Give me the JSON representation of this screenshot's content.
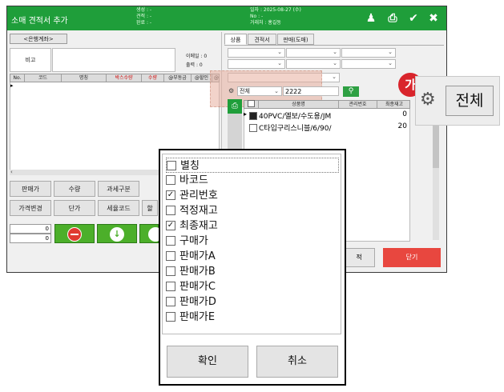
{
  "window": {
    "title": "소매 견적서 추가",
    "meta_left": [
      "생성 : -",
      "견적 : -",
      "완료 : -"
    ],
    "meta_right": [
      "일자 : 2025-08-27 (수)",
      "No : -",
      "거래처 : 홍길동"
    ]
  },
  "left": {
    "customer_button": "<은행계좌>",
    "memo_label": "비고",
    "summary": [
      "이메일 : 0",
      "출력 : 0"
    ],
    "grid_columns": [
      "No.",
      "코드",
      "명칭",
      "박스수량",
      "수량",
      "@부동금",
      "@할인",
      "@"
    ],
    "grid_column_colors": [
      "#222222",
      "#222222",
      "#222222",
      "#d01010",
      "#d01010",
      "#222222",
      "#222222",
      "#222222"
    ],
    "func_row1": [
      "판매가",
      "수량",
      "과세구분"
    ],
    "func_row2": [
      "가격변경",
      "단가",
      "세율코드",
      "할"
    ],
    "number_inputs": [
      "0",
      "0"
    ]
  },
  "right": {
    "tabs": [
      "상품",
      "견적서",
      "판매(도매)"
    ],
    "filter_select": "전체",
    "search_value": "2222",
    "grid_columns": [
      "상품명",
      "관리번호",
      "최종재고"
    ],
    "rows": [
      {
        "name": "40PVC/엘보/수도용/JM",
        "stock": "0"
      },
      {
        "name": "C타입구리스니블/6/90/",
        "stock": "20"
      }
    ],
    "bottom_button": "적",
    "close_button": "닫기"
  },
  "callout": {
    "badge": "가",
    "label": "전체"
  },
  "column_picker": {
    "items": [
      {
        "label": "별칭",
        "checked": false
      },
      {
        "label": "바코드",
        "checked": false
      },
      {
        "label": "관리번호",
        "checked": true
      },
      {
        "label": "적정재고",
        "checked": false
      },
      {
        "label": "최종재고",
        "checked": true
      },
      {
        "label": "구매가",
        "checked": false
      },
      {
        "label": "판매가A",
        "checked": false
      },
      {
        "label": "판매가B",
        "checked": false
      },
      {
        "label": "판매가C",
        "checked": false
      },
      {
        "label": "판매가D",
        "checked": false
      },
      {
        "label": "판매가E",
        "checked": false
      }
    ],
    "confirm": "확인",
    "cancel": "취소"
  },
  "colors": {
    "titlebar": "#1f9e3a",
    "close_red": "#e8473f",
    "highlight": "#e8b0a0",
    "badge_red": "#d9252c",
    "action_green": "#4caf2a"
  }
}
